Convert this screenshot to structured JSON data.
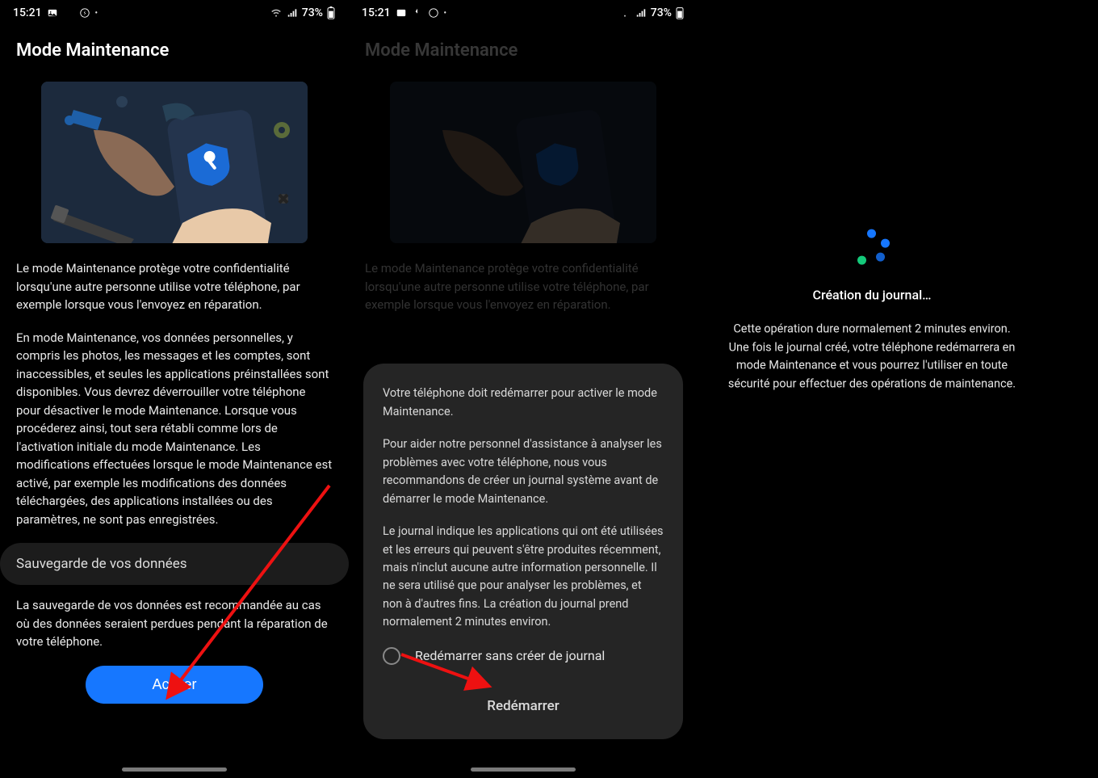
{
  "status": {
    "time": "15:21",
    "battery": "73%"
  },
  "screen1": {
    "title": "Mode Maintenance",
    "para1": "Le mode Maintenance protège votre confidentialité lorsqu'une autre personne utilise votre téléphone, par exemple lorsque vous l'envoyez en réparation.",
    "para2": "En mode Maintenance, vos données personnelles, y compris les photos, les messages et les comptes, sont inaccessibles, et seules les applications préinstallées sont disponibles. Vous devrez déverrouiller votre téléphone pour désactiver le mode Maintenance. Lorsque vous procéderez ainsi, tout sera rétabli comme lors de l'activation initiale du mode Maintenance. Les modifications effectuées lorsque le mode Maintenance est activé, par exemple les modifications des données téléchargées, des applications installées ou des paramètres, ne sont pas enregistrées.",
    "backup_label": "Sauvegarde de vos données",
    "para3": "La sauvegarde de vos données est recommandée au cas où des données seraient perdues pendant la réparation de votre téléphone.",
    "cta": "Activer"
  },
  "screen2": {
    "title": "Mode Maintenance",
    "dim_para": "Le mode Maintenance protège votre confidentialité lorsqu'une autre personne utilise votre téléphone, par exemple lorsque vous l'envoyez en réparation.",
    "dialog": {
      "p1": "Votre téléphone doit redémarrer pour activer le mode Maintenance.",
      "p2": "Pour aider notre personnel d'assistance à analyser les problèmes avec votre téléphone, nous vous recommandons de créer un journal système avant de démarrer le mode Maintenance.",
      "p3": "Le journal indique les applications qui ont été utilisées et les erreurs qui peuvent s'être produites récemment, mais n'inclut aucune autre information personnelle. Il ne sera utilisé que pour analyser les problèmes, et non à d'autres fins. La création du journal prend normalement 2 minutes environ.",
      "radio": "Redémarrer sans créer de journal",
      "action": "Redémarrer"
    }
  },
  "screen3": {
    "title": "Création du journal…",
    "body": "Cette opération dure normalement 2 minutes environ. Une fois le journal créé, votre téléphone redémarrera en mode Maintenance et vous pourrez l'utiliser en toute sécurité pour effectuer des opérations de maintenance."
  }
}
